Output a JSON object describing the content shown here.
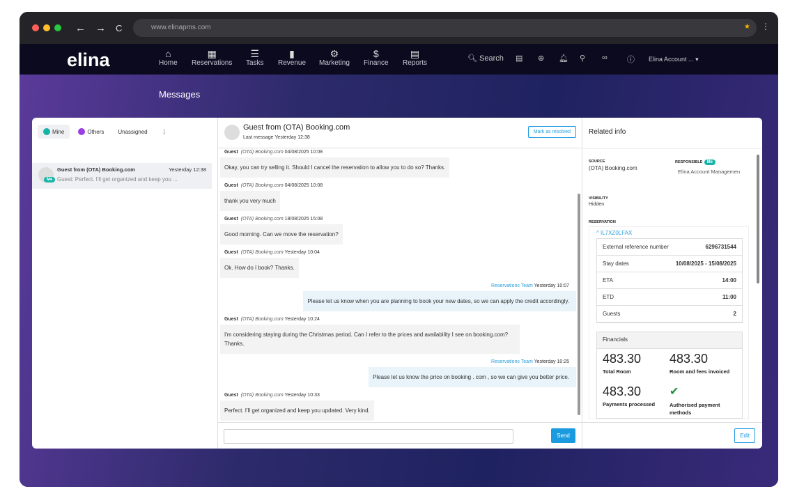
{
  "browser": {
    "url": "www.elinapms.com"
  },
  "nav": {
    "logo": "elina",
    "items": [
      {
        "label": "Home",
        "icon": "⌂"
      },
      {
        "label": "Reservations",
        "icon": "▦"
      },
      {
        "label": "Tasks",
        "icon": "☰"
      },
      {
        "label": "Revenue",
        "icon": "▮"
      },
      {
        "label": "Marketing",
        "icon": "⚙"
      },
      {
        "label": "Finance",
        "icon": "$"
      },
      {
        "label": "Reports",
        "icon": "▤"
      }
    ],
    "search": "Search",
    "account": "Elina Account ..."
  },
  "page": {
    "title": "Messages"
  },
  "left": {
    "tabs": {
      "mine": "Mine",
      "others": "Others",
      "unassigned": "Unassigned"
    },
    "colors": {
      "mine": "#17b3a8",
      "others": "#9b3fe0"
    },
    "conversation": {
      "name": "Guest from (OTA) Booking.com",
      "time": "Yesterday 12:38",
      "preview": "Guest: Perfect. I'll get organized and keep you ...",
      "badge": "Me"
    }
  },
  "chat": {
    "title": "Guest from (OTA) Booking.com",
    "subtitle": "Last message Yesterday 12:38",
    "resolve": "Mark as resolved",
    "send": "Send",
    "messages": [
      {
        "dir": "in",
        "sender": "Guest",
        "source": "(OTA) Booking.com",
        "time": "04/08/2025 10:08",
        "text": "Okay, you can try selling it. Should I cancel the reservation to allow you to do so? Thanks."
      },
      {
        "dir": "in",
        "sender": "Guest",
        "source": "(OTA) Booking.com",
        "time": "04/08/2025 10:08",
        "text": "thank you very much"
      },
      {
        "dir": "in",
        "sender": "Guest",
        "source": "(OTA) Booking.com",
        "time": "18/08/2025 15:08",
        "text": "Good morning. Can we move the reservation?"
      },
      {
        "dir": "in",
        "sender": "Guest",
        "source": "(OTA) Booking.com",
        "time": "Yesterday 10:04",
        "text": "Ok. How do I book? Thanks."
      },
      {
        "dir": "out",
        "sender": "Reservations Team",
        "time": "Yesterday 10:07",
        "text": "Please let us know when you are planning to book your new dates, so we can apply the credit accordingly."
      },
      {
        "dir": "in",
        "sender": "Guest",
        "source": "(OTA) Booking.com",
        "time": "Yesterday 10:24",
        "text": "I'm considering staying during the Christmas period. Can I refer to the prices and availability I see on booking.com? Thanks."
      },
      {
        "dir": "out",
        "sender": "Reservations Team",
        "time": "Yesterday 10:25",
        "text": "Please let us know the price on booking . com , so we can give you better price."
      },
      {
        "dir": "in",
        "sender": "Guest",
        "source": "(OTA) Booking.com",
        "time": "Yesterday 10:33",
        "text": "Perfect. I'll get organized and keep you updated. Very kind."
      }
    ]
  },
  "related": {
    "title": "Related info",
    "source_label": "SOURCE",
    "source": "(OTA) Booking.com",
    "responsible_label": "RESPONSIBLE",
    "responsible_badge": "Me",
    "responsible": "Elina Account Managemen",
    "visibility_label": "VISIBILITY",
    "visibility": "Hidden",
    "reservation_label": "RESERVATION",
    "reservation_code": "^ IL7XZ0LFAX",
    "rows": [
      {
        "k": "External reference number",
        "v": "6296731544"
      },
      {
        "k": "Stay dates",
        "v": "10/08/2025 - 15/08/2025"
      },
      {
        "k": "ETA",
        "v": "14:00"
      },
      {
        "k": "ETD",
        "v": "11:00"
      },
      {
        "k": "Guests",
        "v": "2"
      }
    ],
    "financials": {
      "title": "Financials",
      "total_room": "483.30",
      "total_room_label": "Total Room",
      "invoiced": "483.30",
      "invoiced_label": "Room and fees invoiced",
      "payments": "483.30",
      "payments_label": "Payments processed",
      "auth_label": "Authorised payment methods"
    },
    "edit": "Edit"
  }
}
